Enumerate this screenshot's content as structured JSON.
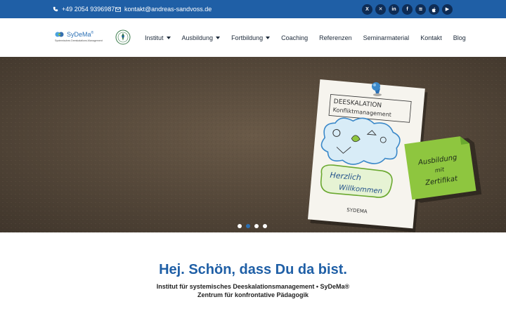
{
  "topbar": {
    "phone": "+49 2054 9396987",
    "email": "kontakt@andreas-sandvoss.de",
    "socials": [
      {
        "name": "x-icon",
        "glyph": "X"
      },
      {
        "name": "xing-icon",
        "glyph": "✕"
      },
      {
        "name": "linkedin-icon",
        "glyph": "in"
      },
      {
        "name": "facebook-icon",
        "glyph": "f"
      },
      {
        "name": "spotify-icon",
        "glyph": "≋"
      },
      {
        "name": "apple-podcasts-icon",
        "glyph": ""
      },
      {
        "name": "youtube-icon",
        "glyph": "▶"
      }
    ]
  },
  "logo": {
    "brand": "SyDeMa",
    "reg": "®",
    "sub": "Systemisches Deeskalations-Management"
  },
  "nav": [
    {
      "label": "Institut",
      "dropdown": true
    },
    {
      "label": "Ausbildung",
      "dropdown": true
    },
    {
      "label": "Fortbildung",
      "dropdown": true
    },
    {
      "label": "Coaching",
      "dropdown": false
    },
    {
      "label": "Referenzen",
      "dropdown": false
    },
    {
      "label": "Seminarmaterial",
      "dropdown": false
    },
    {
      "label": "Kontakt",
      "dropdown": false
    },
    {
      "label": "Blog",
      "dropdown": false
    }
  ],
  "hero": {
    "card_title": "DEESKALATION",
    "card_subtitle": "Konfliktmanagement",
    "card_welcome": "Herzlich",
    "card_welcome2": "Willkommen",
    "card_footer": "SYDEMA",
    "note_line1": "Ausbildung",
    "note_line2": "mit",
    "note_line3": "Zertifikat",
    "slides": 4,
    "active_slide": 2
  },
  "intro": {
    "heading": "Hej. Schön, dass Du da bist.",
    "line1": "Institut für systemisches Deeskalationsmanagement • SyDeMa®",
    "line2": "Zentrum für konfrontative Pädagogik"
  },
  "colors": {
    "primary": "#1f5fa6",
    "dark": "#0e2c55",
    "hero_bg": "#5a4d3f",
    "note": "#8ec63f"
  }
}
